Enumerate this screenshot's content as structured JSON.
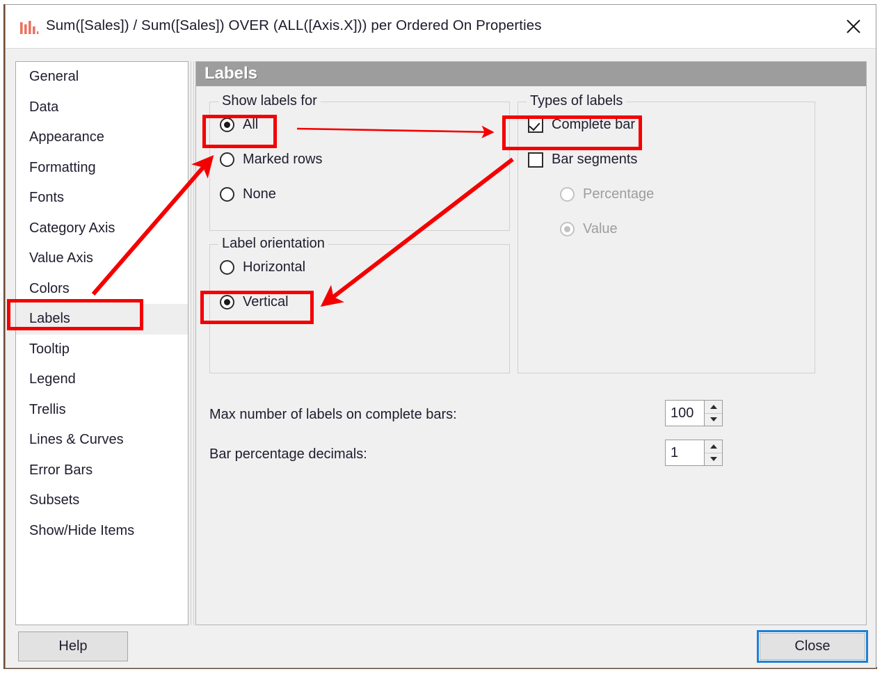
{
  "window": {
    "title": "Sum([Sales]) / Sum([Sales]) OVER (ALL([Axis.X])) per Ordered On Properties",
    "icon": "bar-chart-icon",
    "close_icon": "close-icon",
    "accent_highlight": "#f40000",
    "focus_ring": "#1e7fd4",
    "header_bar": "#9d9d9d"
  },
  "sidebar": {
    "items": [
      {
        "label": "General",
        "selected": false
      },
      {
        "label": "Data",
        "selected": false
      },
      {
        "label": "Appearance",
        "selected": false
      },
      {
        "label": "Formatting",
        "selected": false
      },
      {
        "label": "Fonts",
        "selected": false
      },
      {
        "label": "Category Axis",
        "selected": false
      },
      {
        "label": "Value Axis",
        "selected": false
      },
      {
        "label": "Colors",
        "selected": false
      },
      {
        "label": "Labels",
        "selected": true
      },
      {
        "label": "Tooltip",
        "selected": false
      },
      {
        "label": "Legend",
        "selected": false
      },
      {
        "label": "Trellis",
        "selected": false
      },
      {
        "label": "Lines & Curves",
        "selected": false
      },
      {
        "label": "Error Bars",
        "selected": false
      },
      {
        "label": "Subsets",
        "selected": false
      },
      {
        "label": "Show/Hide Items",
        "selected": false
      }
    ]
  },
  "content": {
    "header": "Labels",
    "show_labels_for": {
      "title": "Show labels for",
      "options": [
        {
          "label": "All",
          "checked": true,
          "disabled": false
        },
        {
          "label": "Marked rows",
          "checked": false,
          "disabled": false
        },
        {
          "label": "None",
          "checked": false,
          "disabled": false
        }
      ]
    },
    "label_orientation": {
      "title": "Label orientation",
      "options": [
        {
          "label": "Horizontal",
          "checked": false,
          "disabled": false
        },
        {
          "label": "Vertical",
          "checked": true,
          "disabled": false
        }
      ]
    },
    "types_of_labels": {
      "title": "Types of labels",
      "checkboxes": [
        {
          "label": "Complete bar",
          "checked": true
        },
        {
          "label": "Bar segments",
          "checked": false
        }
      ],
      "segment_options": [
        {
          "label": "Percentage",
          "checked": false,
          "disabled": true
        },
        {
          "label": "Value",
          "checked": true,
          "disabled": true
        }
      ]
    },
    "fields": [
      {
        "label": "Max number of labels on complete bars:",
        "value": "100"
      },
      {
        "label": "Bar percentage decimals:",
        "value": "1"
      }
    ]
  },
  "footer": {
    "help_label": "Help",
    "close_label": "Close"
  }
}
